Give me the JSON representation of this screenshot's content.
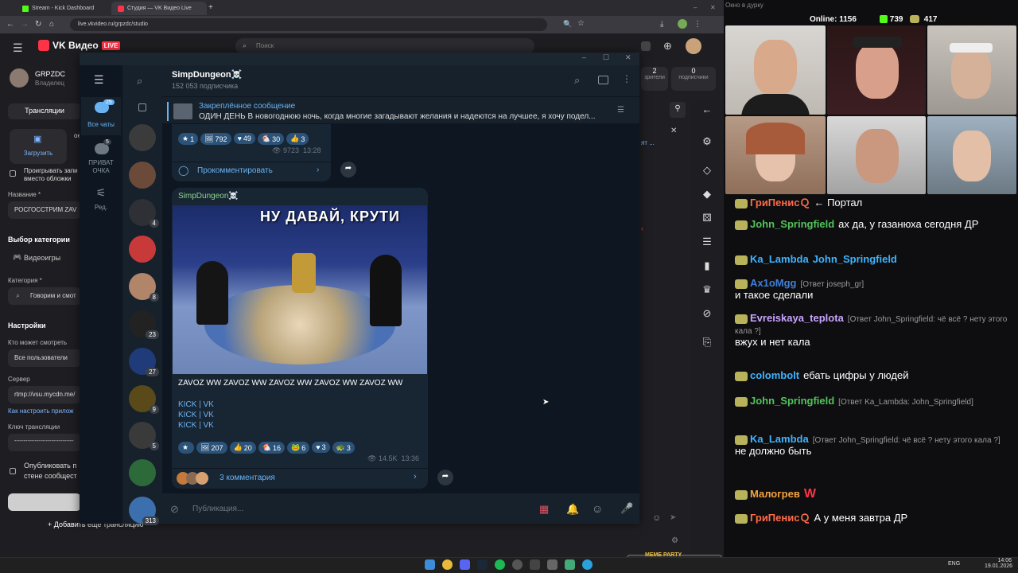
{
  "browser": {
    "tabs": [
      {
        "label": "Stream - Kick Dashboard",
        "color": "#53fc18"
      },
      {
        "label": "Студия — VK Видео Live",
        "color": "#ff3347"
      }
    ],
    "url": "live.vkvideo.ru/grpzdc/studio"
  },
  "vk": {
    "logo": "VK Видео",
    "live_badge": "LIVE",
    "search_placeholder": "Поиск",
    "user_name": "GRPZDC",
    "user_role": "Владелец",
    "broadcasts_tab": "Трансляции",
    "upload_label": "Загрузить",
    "loop_label_1": "Проигрывать запи",
    "loop_label_2": "вместо обложки",
    "title_label": "Название *",
    "title_value": "РОСГОССТРИМ ZAV",
    "category_section": "Выбор категории",
    "category_games": "Видеоигры",
    "category_label": "Категория *",
    "category_value": "Говорим и смот",
    "settings_header": "Настройки",
    "who_can_watch": "Кто может смотреть",
    "who_value": "Все пользователи",
    "server_label": "Сервер",
    "server_value": "rtmp://vsu.mycdn.me/",
    "setup_link": "Как настроить прилож",
    "key_label": "Ключ трансляции",
    "key_value": "--------------------------------",
    "publish_1": "Опубликовать п",
    "publish_2": "стене сообщест",
    "add_broadcast": "Добавить еще трансляцию",
    "stats": [
      {
        "value": "2",
        "label": "зрители"
      },
      {
        "value": "0",
        "label": "подписчики"
      }
    ],
    "partial_text": "ое",
    "partial_link": "ят ..."
  },
  "tg": {
    "folders": [
      {
        "label": "Все чаты",
        "badge": "25"
      },
      {
        "label": "ПРИВАТ ОЧКА",
        "badge": "5"
      },
      {
        "label": "Ред.",
        "badge": ""
      }
    ],
    "chat_badges": [
      "",
      "",
      "4",
      "",
      "8",
      "23",
      "27",
      "9",
      "5",
      "",
      "313"
    ],
    "channel_name": "SimpDungeon☠️",
    "channel_subs": "152 053 подписчика",
    "pinned_title": "Закреплённое сообщение",
    "pinned_text": "ОДИН ДЕНЬ  В новогоднюю ночь, когда многие загадывают желания и надеются на лучшее, я хочу подел...",
    "msg1": {
      "reactions": [
        {
          "emoji": "★",
          "count": "1"
        },
        {
          "emoji": "🖼",
          "count": "792"
        },
        {
          "emoji": "♥",
          "count": "49"
        },
        {
          "emoji": "🐔",
          "count": "30"
        },
        {
          "emoji": "👍",
          "count": "3"
        }
      ],
      "views": "9723",
      "time": "13:28",
      "comment_btn": "Прокомментировать"
    },
    "msg2": {
      "author": "SimpDungeon☠️",
      "image_caption": "НУ ДАВАЙ, КРУТИ",
      "text": "ZAVOZ WW ZAVOZ WW ZAVOZ WW ZAVOZ WW ZAVOZ WW",
      "links": [
        "KICK | VK",
        "KICK | VK",
        "KICK | VK"
      ],
      "reactions": [
        {
          "emoji": "★",
          "count": ""
        },
        {
          "emoji": "🖼",
          "count": "207"
        },
        {
          "emoji": "👍",
          "count": "20"
        },
        {
          "emoji": "🐔",
          "count": "16"
        },
        {
          "emoji": "🐸",
          "count": "6"
        },
        {
          "emoji": "♥",
          "count": "3"
        },
        {
          "emoji": "🐢",
          "count": "3"
        }
      ],
      "views": "14.5K",
      "time": "13:36",
      "comments": "3 комментария"
    },
    "composer_placeholder": "Публикация..."
  },
  "stream": {
    "window_title": "Окно в дурку",
    "online_label": "Online:",
    "online": "1156",
    "kick_count": "739",
    "other_count": "417",
    "chat": [
      {
        "user": "ГриПенисＱ",
        "color": "#ff6b4a",
        "text": "← Портал",
        "reply": ""
      },
      {
        "user": "John_Springfield",
        "color": "#53c35a",
        "text": "ах да, у газанюха сегодня ДР",
        "reply": ""
      },
      {
        "user": "Ka_Lambda",
        "color": "#3db4ff",
        "text": "John_Springfield",
        "reply": ""
      },
      {
        "user": "Ax1oMgg",
        "color": "#3f7fd8",
        "text": "и такое сделали",
        "reply": "[Ответ joseph_gr]"
      },
      {
        "user": "Evreiskaya_teplota",
        "color": "#c8a4ff",
        "text": "вжух и нет кала",
        "reply": "[Ответ John_Springfield: чё всё ? нету этого кала ?]"
      },
      {
        "user": "colombolt",
        "color": "#3db4ff",
        "text": "ебать цифры у людей",
        "reply": ""
      },
      {
        "user": "John_Springfield",
        "color": "#53c35a",
        "text": "",
        "reply": "[Ответ Ka_Lambda: John_Springfield]"
      },
      {
        "user": "Ka_Lambda",
        "color": "#3db4ff",
        "text": "не должно быть",
        "reply": "[Ответ John_Springfield: чё всё ? нету этого кала ?]"
      },
      {
        "user": "Малогрев",
        "color": "#f4a340",
        "text": "W",
        "reply": ""
      },
      {
        "user": "ГриПенисＱ",
        "color": "#ff6b4a",
        "text": "А у меня завтра ДР",
        "reply": ""
      }
    ],
    "overlay_tag": "MEME PARTY"
  },
  "taskbar": {
    "lang": "ENG",
    "time": "14:06",
    "date": "19.01.2026"
  },
  "colors": {
    "vk_red": "#ff3347",
    "tg_bg": "#0e1621",
    "tg_link": "#6ab3f3",
    "kick_green": "#53fc18"
  }
}
